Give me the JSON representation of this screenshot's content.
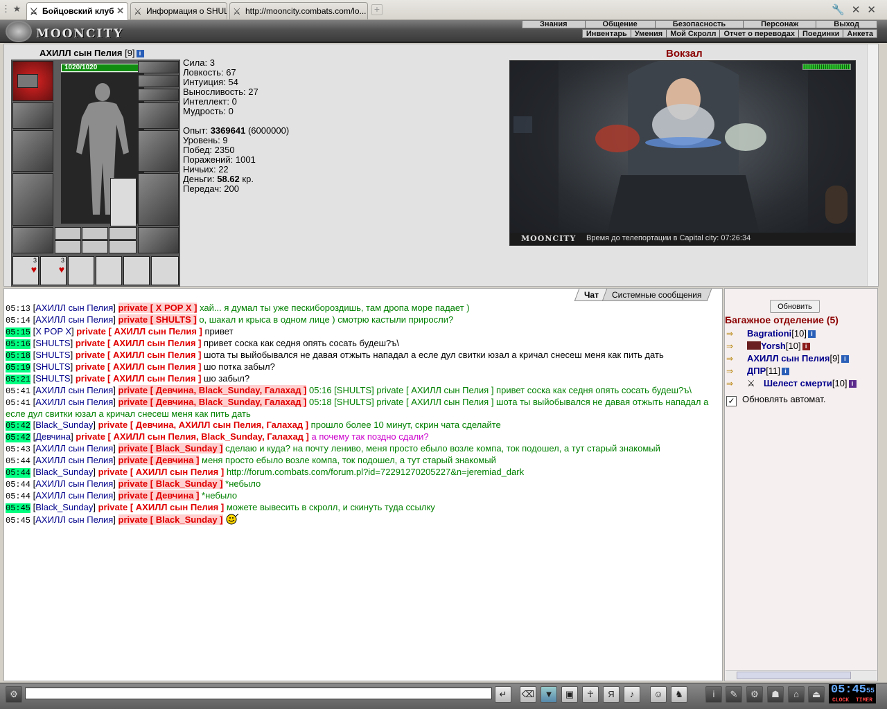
{
  "browser": {
    "tabs": [
      {
        "title": "Бойцовский клуб",
        "active": true
      },
      {
        "title": "Информация о SHULTS"
      },
      {
        "title": "http://mooncity.combats.com/lo..."
      }
    ]
  },
  "header": {
    "logo": "MOONCITY",
    "nav_top": [
      "Знания",
      "Общение",
      "Безопасность",
      "Персонаж",
      "Выход"
    ],
    "nav_bottom": [
      "Инвентарь",
      "Умения",
      "Мой Скролл",
      "Отчет о переводах",
      "Поединки",
      "Анкета"
    ]
  },
  "character": {
    "name": "АХИЛЛ сын Пелия",
    "level": "[9]",
    "hp": "1020/1020",
    "stats": [
      {
        "label": "Сила:",
        "value": "3"
      },
      {
        "label": "Ловкость:",
        "value": "67"
      },
      {
        "label": "Интуиция:",
        "value": "54"
      },
      {
        "label": "Выносливость:",
        "value": "27"
      },
      {
        "label": "Интеллект:",
        "value": "0"
      },
      {
        "label": "Мудрость:",
        "value": "0"
      }
    ],
    "exp_label": "Опыт:",
    "exp_value": "3369641",
    "exp_next": "(6000000)",
    "details": [
      {
        "label": "Уровень:",
        "value": "9"
      },
      {
        "label": "Побед:",
        "value": "2350"
      },
      {
        "label": "Поражений:",
        "value": "1001"
      },
      {
        "label": "Ничьих:",
        "value": "22"
      }
    ],
    "money_label": "Деньги:",
    "money_value": "58.62",
    "money_unit": "кр.",
    "transfers_label": "Передач:",
    "transfers_value": "200",
    "potion_count_1": "3",
    "potion_count_2": "3"
  },
  "location": {
    "name": "Вокзал",
    "logo": "MOONCITY",
    "teleport": "Время до телепортации в Capital city: 07:26:34"
  },
  "chat": {
    "tabs": [
      "Чат",
      "Системные сообщения"
    ],
    "messages": [
      {
        "time": "05:13",
        "hl": false,
        "nick": "АХИЛЛ сын Пелия",
        "to": "private [ X POP X ]",
        "pink": true,
        "text": "хай... я думал ты уже пескибороздишь, там дропа море падает )",
        "color": "txtg"
      },
      {
        "time": "05:14",
        "hl": false,
        "nick": "АХИЛЛ сын Пелия",
        "to": "private [ SHULTS ]",
        "pink": true,
        "text": "о, шакал и крыса в одном лице ) смотрю кастыли приросли?",
        "color": "txtg"
      },
      {
        "time": "05:15",
        "hl": true,
        "nick": "X POP X",
        "to": "private [ АХИЛЛ сын Пелия ]",
        "pink": false,
        "text": "привет",
        "color": "txtb"
      },
      {
        "time": "05:16",
        "hl": true,
        "nick": "SHULTS",
        "to": "private [ АХИЛЛ сын Пелия ]",
        "pink": false,
        "text": "привет соска как седня опять сосать будеш?ъ\\",
        "color": "txtb"
      },
      {
        "time": "05:18",
        "hl": true,
        "nick": "SHULTS",
        "to": "private [ АХИЛЛ сын Пелия ]",
        "pink": false,
        "text": "шота ты выйобывался не давая отжыть нападал а есле дул свитки юзал а кричал снесеш меня как пить дать",
        "color": "txtb"
      },
      {
        "time": "05:19",
        "hl": true,
        "nick": "SHULTS",
        "to": "private [ АХИЛЛ сын Пелия ]",
        "pink": false,
        "text": "шо потка забыл?",
        "color": "txtb"
      },
      {
        "time": "05:21",
        "hl": true,
        "nick": "SHULTS",
        "to": "private [ АХИЛЛ сын Пелия ]",
        "pink": false,
        "text": "шо забыл?",
        "color": "txtb"
      },
      {
        "time": "05:41",
        "hl": false,
        "nick": "АХИЛЛ сын Пелия",
        "to": "private [ Девчина, Black_Sunday, Галахад ]",
        "pink": true,
        "text": "05:16 [SHULTS] private [ АХИЛЛ сын Пелия ] привет соска как седня опять сосать будеш?ъ\\",
        "color": "txtg"
      },
      {
        "time": "05:41",
        "hl": false,
        "nick": "АХИЛЛ сын Пелия",
        "to": "private [ Девчина, Black_Sunday, Галахад ]",
        "pink": true,
        "text": "05:18 [SHULTS] private [ АХИЛЛ сын Пелия ] шота ты выйобывался не давая отжыть нападал а есле дул свитки юзал а кричал снесеш меня как пить дать",
        "color": "txtg"
      },
      {
        "time": "05:42",
        "hl": true,
        "nick": "Black_Sunday",
        "to": "private [ Девчина, АХИЛЛ сын Пелия, Галахад ]",
        "pink": false,
        "text": "прошло более 10 минут, скрин чата сделайте",
        "color": "txtg"
      },
      {
        "time": "05:42",
        "hl": true,
        "nick": "Девчина",
        "to": "private [ АХИЛЛ сын Пелия, Black_Sunday, Галахад ]",
        "pink": false,
        "text": "а почему так поздно сдали?",
        "color": "txtm"
      },
      {
        "time": "05:43",
        "hl": false,
        "nick": "АХИЛЛ сын Пелия",
        "to": "private [ Black_Sunday ]",
        "pink": true,
        "text": "сделаю и куда? на почту лениво, меня просто ебыло возле компа, ток подошел, а тут старый знакомый",
        "color": "txtg"
      },
      {
        "time": "05:44",
        "hl": false,
        "nick": "АХИЛЛ сын Пелия",
        "to": "private [ Девчина ]",
        "pink": true,
        "text": "меня просто ебыло возле компа, ток подошел, а тут старый знакомый",
        "color": "txtg"
      },
      {
        "time": "05:44",
        "hl": true,
        "nick": "Black_Sunday",
        "to": "private [ АХИЛЛ сын Пелия ]",
        "pink": false,
        "text": "http://forum.combats.com/forum.pl?id=72291270205227&n=jeremiad_dark",
        "color": "txtg"
      },
      {
        "time": "05:44",
        "hl": false,
        "nick": "АХИЛЛ сын Пелия",
        "to": "private [ Black_Sunday ]",
        "pink": true,
        "text": "*небыло",
        "color": "txtg"
      },
      {
        "time": "05:44",
        "hl": false,
        "nick": "АХИЛЛ сын Пелия",
        "to": "private [ Девчина ]",
        "pink": true,
        "text": "*небыло",
        "color": "txtg"
      },
      {
        "time": "05:45",
        "hl": true,
        "nick": "Black_Sunday",
        "to": "private [ АХИЛЛ сын Пелия ]",
        "pink": false,
        "text": "можете вывесить в скролл, и скинуть туда ссылку",
        "color": "txtg"
      },
      {
        "time": "05:45",
        "hl": false,
        "nick": "АХИЛЛ сын Пелия",
        "to": "private [ Black_Sunday ]",
        "pink": true,
        "text": "",
        "color": "txtg",
        "smiley": true
      }
    ]
  },
  "room": {
    "refresh": "Обновить",
    "title": "Багажное отделение (5)",
    "users": [
      {
        "name": "Bagrationi",
        "level": "[10]"
      },
      {
        "name": "Yorsh",
        "level": "[10]"
      },
      {
        "name": "АХИЛЛ сын Пелия",
        "level": "[9]"
      },
      {
        "name": "ДПР",
        "level": "[11]"
      },
      {
        "name": "Шелест смерти",
        "level": "[10]"
      }
    ],
    "auto_update": "Обновлять автомат."
  },
  "bottom": {
    "clock": "05:45",
    "clock_sec": "55",
    "clock_label": "CLOCK",
    "timer_label": "TIMER"
  }
}
